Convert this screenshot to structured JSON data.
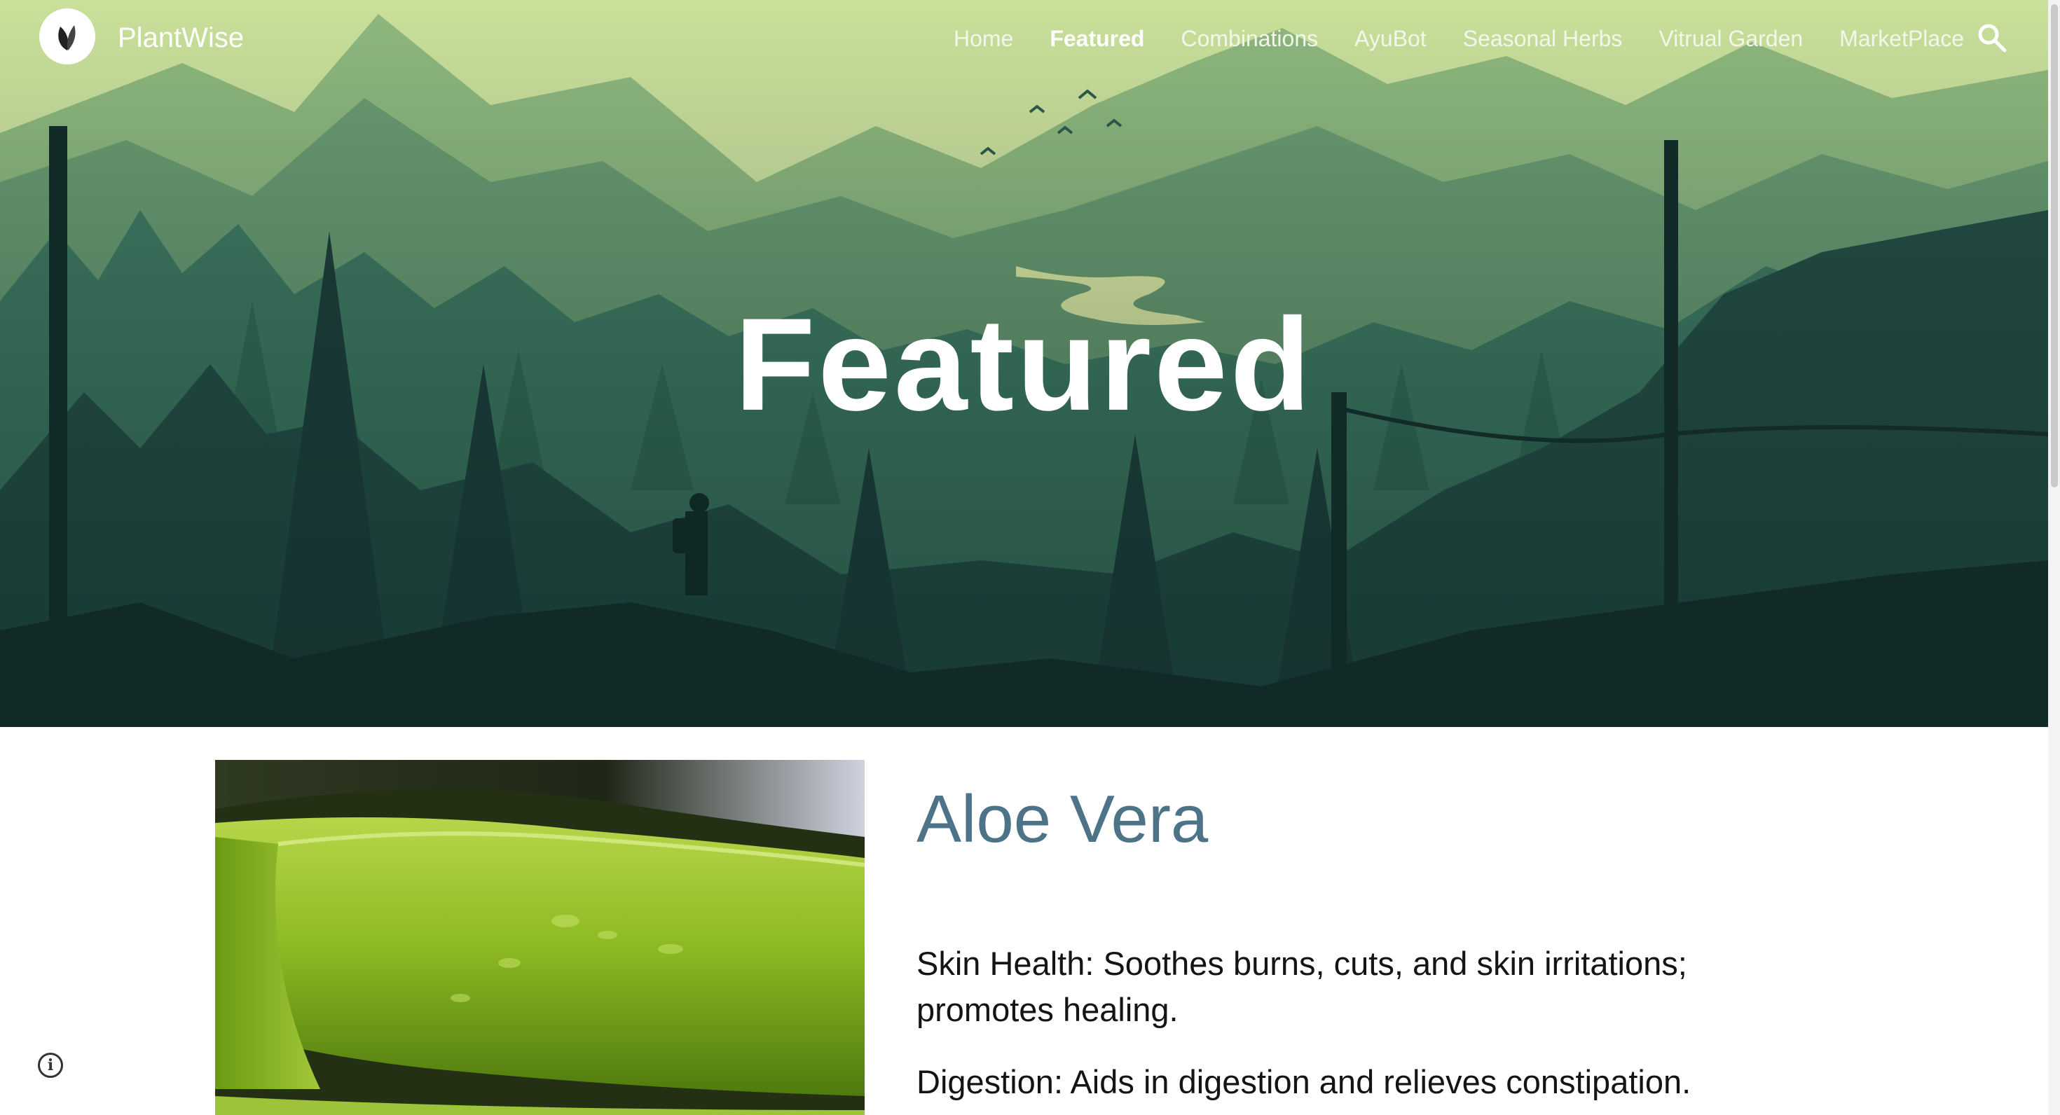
{
  "brand": {
    "name": "PlantWise",
    "logo_icon": "leaf-icon"
  },
  "nav": {
    "items": [
      {
        "label": "Home",
        "active": false
      },
      {
        "label": "Featured",
        "active": true
      },
      {
        "label": "Combinations",
        "active": false
      },
      {
        "label": "AyuBot",
        "active": false
      },
      {
        "label": "Seasonal Herbs",
        "active": false
      },
      {
        "label": "Vitrual Garden",
        "active": false
      },
      {
        "label": "MarketPlace",
        "active": false
      }
    ],
    "search_icon": "search-icon"
  },
  "hero": {
    "title": "Featured"
  },
  "article": {
    "title": "Aloe Vera",
    "benefits": [
      "Skin Health: Soothes burns, cuts, and skin irritations; promotes healing.",
      "Digestion: Aids in digestion and relieves constipation."
    ]
  },
  "footer": {
    "info_icon": "info-icon"
  },
  "colors": {
    "sky": "#d4e8a0",
    "forest_dark": "#16312e",
    "heading": "#4c7388",
    "body_text": "#141414"
  }
}
